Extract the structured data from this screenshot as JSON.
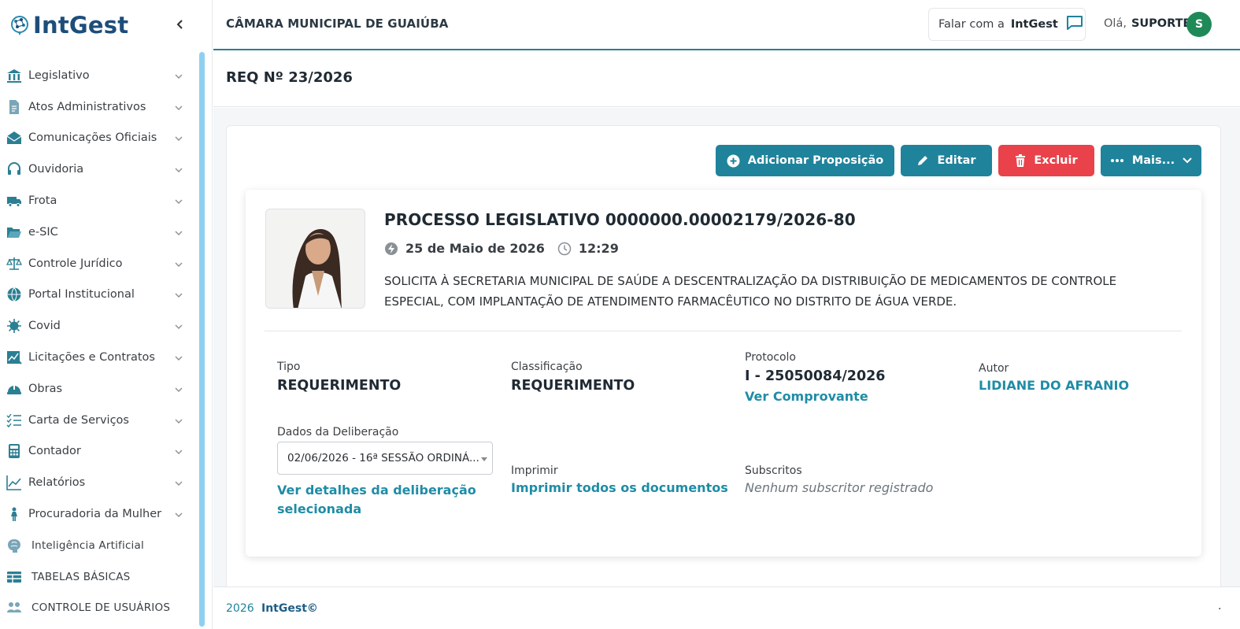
{
  "app": {
    "logo_text_brand": "IntGest",
    "org_name": "CÂMARA MUNICIPAL DE GUAIÚBA"
  },
  "sidebar": {
    "items": [
      {
        "label": "Legislativo",
        "icon": "bank-icon"
      },
      {
        "label": "Atos Administrativos",
        "icon": "document-icon"
      },
      {
        "label": "Comunicações Oficiais",
        "icon": "mail-open-icon"
      },
      {
        "label": "Ouvidoria",
        "icon": "headset-icon"
      },
      {
        "label": "Frota",
        "icon": "truck-icon"
      },
      {
        "label": "e-SIC",
        "icon": "folder-open-icon"
      },
      {
        "label": "Controle Jurídico",
        "icon": "scales-icon"
      },
      {
        "label": "Portal Institucional",
        "icon": "globe-icon"
      },
      {
        "label": "Covid",
        "icon": "virus-icon"
      },
      {
        "label": "Licitações e Contratos",
        "icon": "chart-doc-icon"
      },
      {
        "label": "Obras",
        "icon": "helmet-icon"
      },
      {
        "label": "Carta de Serviços",
        "icon": "checklist-icon"
      },
      {
        "label": "Contador",
        "icon": "calculator-icon"
      },
      {
        "label": "Relatórios",
        "icon": "line-chart-icon"
      },
      {
        "label": "Procuradoria da Mulher",
        "icon": "woman-icon"
      },
      {
        "label": "Inteligência Artificial",
        "icon": "brain-icon"
      },
      {
        "label": "TABELAS BÁSICAS",
        "icon": "table-icon"
      },
      {
        "label": "CONTROLE DE USUÁRIOS",
        "icon": "users-icon"
      }
    ]
  },
  "topbar": {
    "talk_prefix": "Falar com a",
    "talk_brand": "IntGest",
    "hello": "Olá,",
    "user_name": "SUPORTE",
    "avatar_initial": "S"
  },
  "page": {
    "title": "REQ Nº 23/2026"
  },
  "actions": {
    "add": "Adicionar Proposição",
    "edit": "Editar",
    "delete": "Excluir",
    "more": "Mais..."
  },
  "process": {
    "title": "PROCESSO LEGISLATIVO 0000000.00002179/2026-80",
    "date": "25 de Maio de 2026",
    "time": "12:29",
    "ementa": "SOLICITA À SECRETARIA MUNICIPAL DE SAÚDE A DESCENTRALIZAÇÃO DA DISTRIBUIÇÃO DE MEDICAMENTOS DE CONTROLE ESPECIAL, COM IMPLANTAÇÃO DE ATENDIMENTO FARMACÊUTICO NO DISTRITO DE ÁGUA VERDE."
  },
  "fields": {
    "tipo_label": "Tipo",
    "tipo_value": "REQUERIMENTO",
    "classificacao_label": "Classificação",
    "classificacao_value": "REQUERIMENTO",
    "protocolo_label": "Protocolo",
    "protocolo_value": "I - 25050084/2026",
    "protocolo_link": "Ver Comprovante",
    "autor_label": "Autor",
    "autor_value": "LIDIANE DO AFRANIO",
    "deliberacao_label": "Dados da Deliberação",
    "deliberacao_selected": "02/06/2026 - 16ª SESSÃO ORDINÁ...",
    "deliberacao_link": "Ver detalhes da deliberação selecionada",
    "imprimir_label": "Imprimir",
    "imprimir_link": "Imprimir todos os documentos",
    "subscritos_label": "Subscritos",
    "subscritos_value": "Nenhum subscritor registrado"
  },
  "footer": {
    "year": "2026",
    "brand": "IntGest©",
    "dot": "."
  },
  "colors": {
    "primary": "#1f839c",
    "danger": "#e9424a",
    "link": "#1f8ca6",
    "avatar": "#1f8a58",
    "scrollbar": "#8fd0f0"
  }
}
